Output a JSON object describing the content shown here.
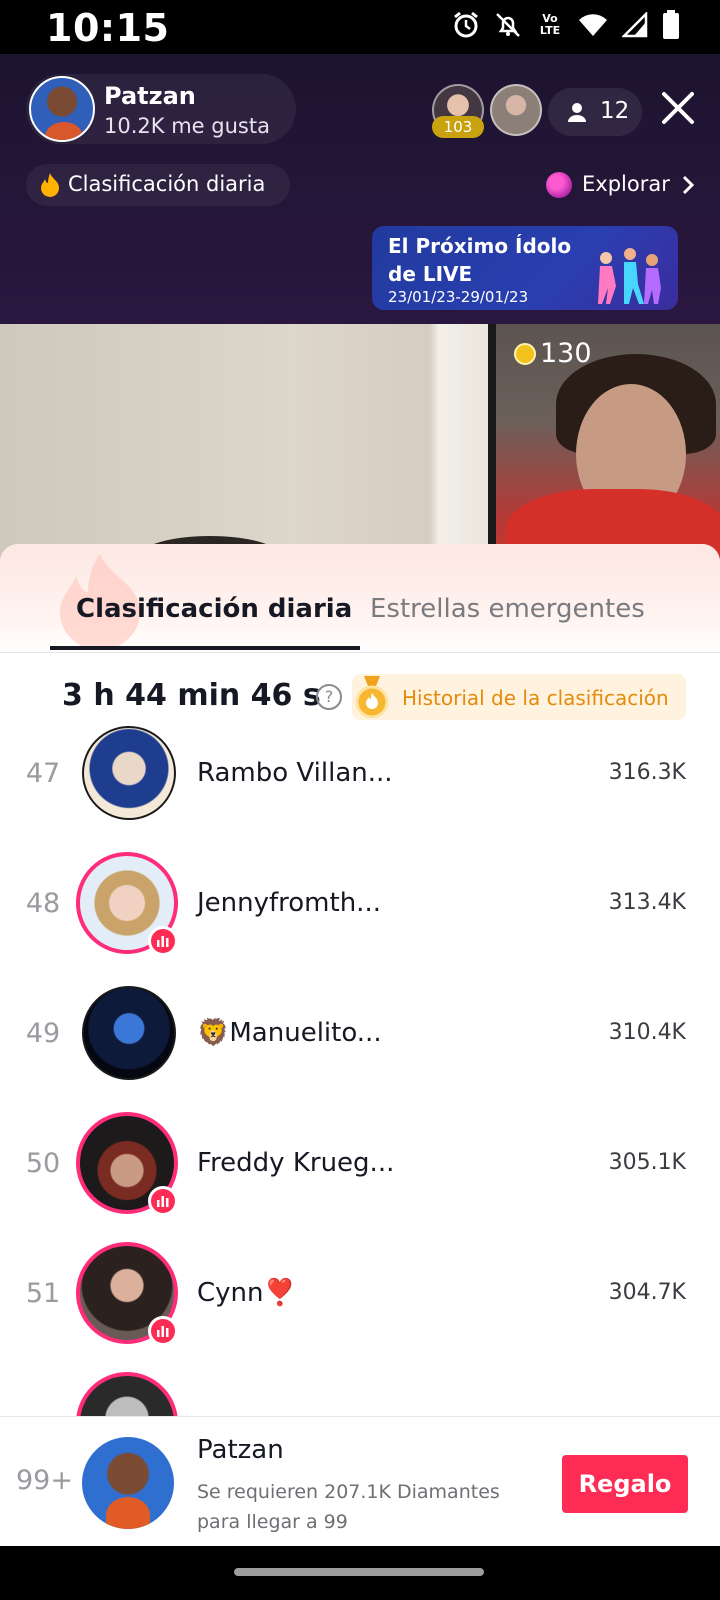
{
  "status_bar": {
    "time": "10:15",
    "icons": [
      "alarm-icon",
      "bell-off-icon",
      "volte-icon",
      "wifi-icon",
      "signal-icon",
      "battery-icon"
    ],
    "volte_label": "Vo LTE"
  },
  "live_header": {
    "host_name": "Patzan",
    "host_likes": "10.2K me gusta",
    "top_viewer_badge": "103",
    "viewer_count": "12",
    "daily_ranking_label": "Clasificación diaria",
    "explore_label": "Explorar",
    "banner": {
      "line1": "El Próximo Ídolo",
      "line2": "de LIVE",
      "dates": "23/01/23-29/01/23"
    }
  },
  "video": {
    "coins": "130"
  },
  "sheet": {
    "tabs": [
      {
        "label": "Clasificación diaria",
        "active": true
      },
      {
        "label": "Estrellas emergentes",
        "active": false
      }
    ],
    "timer": "3 h 44 min 46 s",
    "help_symbol": "?",
    "history_label": "Historial de la clasificación",
    "ranking": [
      {
        "rank": "47",
        "name": "Rambo Villan...",
        "score": "316.3K",
        "live": false
      },
      {
        "rank": "48",
        "name": "Jennyfromth...",
        "score": "313.4K",
        "live": true
      },
      {
        "rank": "49",
        "name": "🦁Manuelito...",
        "score": "310.4K",
        "live": false
      },
      {
        "rank": "50",
        "name": "Freddy Krueg...",
        "score": "305.1K",
        "live": true
      },
      {
        "rank": "51",
        "name": "Cynn❣️",
        "score": "304.7K",
        "live": true
      }
    ]
  },
  "footer": {
    "rank": "99+",
    "name": "Patzan",
    "requirement_line1": "Se requieren 207.1K Diamantes",
    "requirement_line2": "para llegar a 99",
    "gift_button": "Regalo"
  },
  "colors": {
    "accent": "#fe2c55",
    "history_text": "#e38b0c",
    "header_bg": "#241638"
  }
}
